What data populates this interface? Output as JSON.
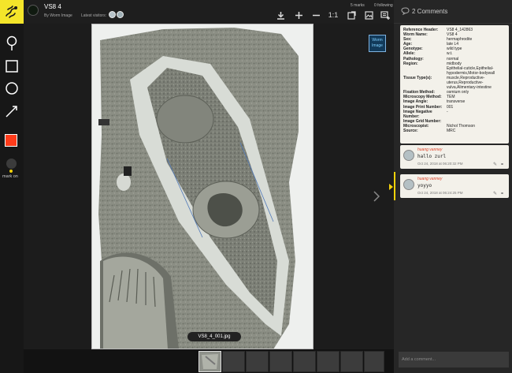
{
  "header": {
    "title": "VS8 4",
    "author": "By Worm Image",
    "visitors_label": "Latest visitors:",
    "marks": "5 marks",
    "following": "0 following",
    "zoom_reset": "1:1"
  },
  "tools": {
    "mark_label": "mark on",
    "color": "#ff3b1a"
  },
  "viewer": {
    "filename": "VS8_4_001.jpg",
    "badge_line1": "Worm",
    "badge_line2": "Image"
  },
  "comments": {
    "title": "2 Comments",
    "info": [
      {
        "key": "Reference Header:",
        "value": "VS8 4_142863"
      },
      {
        "key": "Worm Name:",
        "value": "VS8 4"
      },
      {
        "key": "Sex:",
        "value": "hermaphrodite"
      },
      {
        "key": "Age:",
        "value": "late L4"
      },
      {
        "key": "Genotype:",
        "value": "wild type"
      },
      {
        "key": "Allele:",
        "value": "w.t."
      },
      {
        "key": "Pathology:",
        "value": "normal"
      },
      {
        "key": "Region:",
        "value": "midbody"
      },
      {
        "key": "",
        "value": "Epithelial-cuticle,Epithelial-"
      },
      {
        "key": "",
        "value": "hypodermis,Motor-bodywall"
      },
      {
        "key": "Tissue Type(s):",
        "value": "muscle,Reproductive-"
      },
      {
        "key": "",
        "value": "uterus,Reproductive-"
      },
      {
        "key": "",
        "value": "vulva,Alimentary-intestine"
      },
      {
        "key": "Fixation Method:",
        "value": "osmium only"
      },
      {
        "key": "Microscopy Method:",
        "value": "TEM"
      },
      {
        "key": "Image Angle:",
        "value": "transverse"
      },
      {
        "key": "Image Print Number:",
        "value": "001"
      },
      {
        "key": "Image Negative Number:",
        "value": "-"
      },
      {
        "key": "Image Grid Number:",
        "value": ""
      },
      {
        "key": "Microscopist:",
        "value": "Nichol Thomson"
      },
      {
        "key": "Source:",
        "value": "MRC"
      }
    ],
    "items": [
      {
        "user": "huang vanney",
        "text": "hallo zurl",
        "time": "Oct 24, 2018 at 06:20:32 PM"
      },
      {
        "user": "huang vanney",
        "text": "yoyyo",
        "time": "Oct 24, 2018 at 06:24:25 PM"
      }
    ],
    "input_placeholder": "Add a comment..."
  }
}
